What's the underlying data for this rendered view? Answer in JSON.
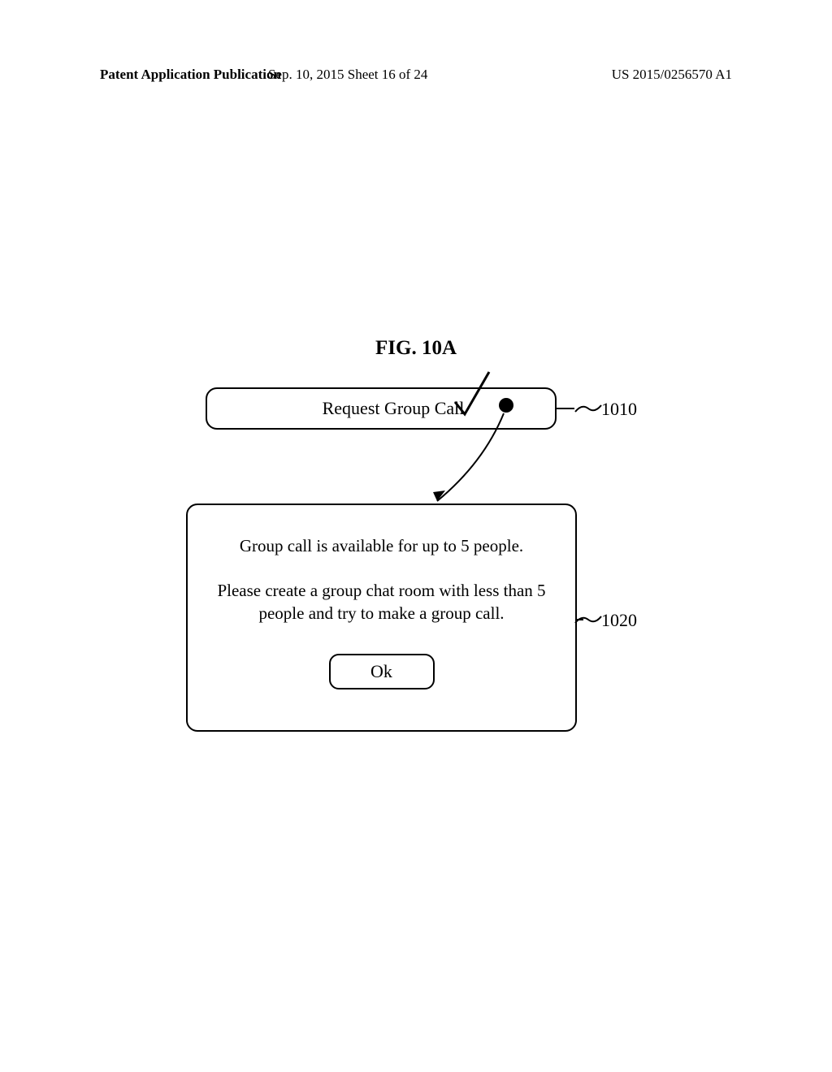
{
  "header": {
    "left": "Patent Application Publication",
    "center": "Sep. 10, 2015  Sheet 16 of 24",
    "right": "US 2015/0256570 A1"
  },
  "figure": {
    "title": "FIG. 10A"
  },
  "request": {
    "label": "Request Group Call"
  },
  "dialog": {
    "line1": "Group call is available for up to 5 people.",
    "line2": "Please create a group chat room with less than 5 people and try to make a group call.",
    "ok_label": "Ok"
  },
  "refs": {
    "r1010": "1010",
    "r1020": "1020"
  }
}
